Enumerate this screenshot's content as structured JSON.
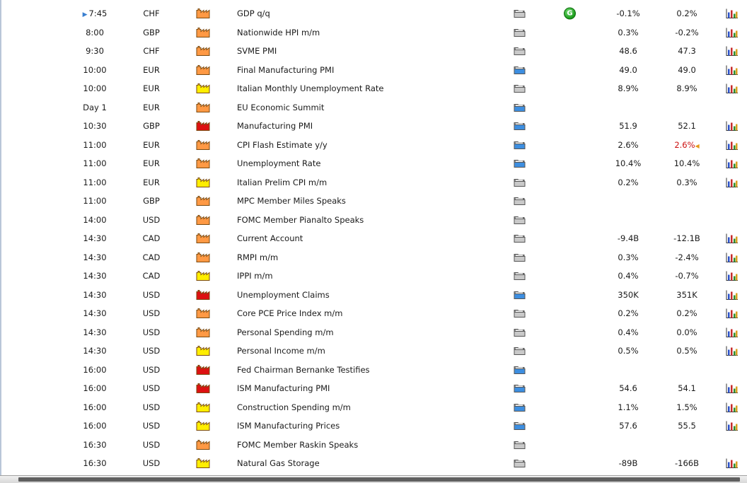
{
  "colors": {
    "high": "#dd1111",
    "medium": "#ff9944",
    "low": "#ffee00"
  },
  "rows": [
    {
      "time": "7:45",
      "currency": "CHF",
      "impact": "medium",
      "event": "GDP q/q",
      "detail": "gray",
      "graph": "G",
      "actual": "-0.1%",
      "forecast": "0.2%",
      "forecast_red": false,
      "chart": true,
      "current": true
    },
    {
      "time": "8:00",
      "currency": "GBP",
      "impact": "medium",
      "event": "Nationwide HPI m/m",
      "detail": "gray",
      "actual": "0.3%",
      "forecast": "-0.2%",
      "forecast_red": false,
      "chart": true
    },
    {
      "time": "9:30",
      "currency": "CHF",
      "impact": "medium",
      "event": "SVME PMI",
      "detail": "gray",
      "actual": "48.6",
      "forecast": "47.3",
      "forecast_red": false,
      "chart": true
    },
    {
      "time": "10:00",
      "currency": "EUR",
      "impact": "medium",
      "event": "Final Manufacturing PMI",
      "detail": "blue",
      "actual": "49.0",
      "forecast": "49.0",
      "forecast_red": false,
      "chart": true
    },
    {
      "time": "10:00",
      "currency": "EUR",
      "impact": "low",
      "event": "Italian Monthly Unemployment Rate",
      "detail": "gray",
      "actual": "8.9%",
      "forecast": "8.9%",
      "forecast_red": false,
      "chart": true
    },
    {
      "time": "Day 1",
      "currency": "EUR",
      "impact": "medium",
      "event": "EU Economic Summit",
      "detail": "blue",
      "actual": "",
      "forecast": "",
      "forecast_red": false,
      "chart": false
    },
    {
      "time": "10:30",
      "currency": "GBP",
      "impact": "high",
      "event": "Manufacturing PMI",
      "detail": "blue",
      "actual": "51.9",
      "forecast": "52.1",
      "forecast_red": false,
      "chart": true
    },
    {
      "time": "11:00",
      "currency": "EUR",
      "impact": "medium",
      "event": "CPI Flash Estimate y/y",
      "detail": "blue",
      "actual": "2.6%",
      "forecast": "2.6%",
      "forecast_red": true,
      "chart": true
    },
    {
      "time": "11:00",
      "currency": "EUR",
      "impact": "medium",
      "event": "Unemployment Rate",
      "detail": "blue",
      "actual": "10.4%",
      "forecast": "10.4%",
      "forecast_red": false,
      "chart": true
    },
    {
      "time": "11:00",
      "currency": "EUR",
      "impact": "low",
      "event": "Italian Prelim CPI m/m",
      "detail": "gray",
      "actual": "0.2%",
      "forecast": "0.3%",
      "forecast_red": false,
      "chart": true
    },
    {
      "time": "11:00",
      "currency": "GBP",
      "impact": "medium",
      "event": "MPC Member Miles Speaks",
      "detail": "gray",
      "actual": "",
      "forecast": "",
      "forecast_red": false,
      "chart": false
    },
    {
      "time": "14:00",
      "currency": "USD",
      "impact": "medium",
      "event": "FOMC Member Pianalto Speaks",
      "detail": "gray",
      "actual": "",
      "forecast": "",
      "forecast_red": false,
      "chart": false
    },
    {
      "time": "14:30",
      "currency": "CAD",
      "impact": "medium",
      "event": "Current Account",
      "detail": "gray",
      "actual": "-9.4B",
      "forecast": "-12.1B",
      "forecast_red": false,
      "chart": true
    },
    {
      "time": "14:30",
      "currency": "CAD",
      "impact": "medium",
      "event": "RMPI m/m",
      "detail": "gray",
      "actual": "0.3%",
      "forecast": "-2.4%",
      "forecast_red": false,
      "chart": true
    },
    {
      "time": "14:30",
      "currency": "CAD",
      "impact": "low",
      "event": "IPPI m/m",
      "detail": "gray",
      "actual": "0.4%",
      "forecast": "-0.7%",
      "forecast_red": false,
      "chart": true
    },
    {
      "time": "14:30",
      "currency": "USD",
      "impact": "high",
      "event": "Unemployment Claims",
      "detail": "blue",
      "actual": "350K",
      "forecast": "351K",
      "forecast_red": false,
      "chart": true
    },
    {
      "time": "14:30",
      "currency": "USD",
      "impact": "medium",
      "event": "Core PCE Price Index m/m",
      "detail": "gray",
      "actual": "0.2%",
      "forecast": "0.2%",
      "forecast_red": false,
      "chart": true
    },
    {
      "time": "14:30",
      "currency": "USD",
      "impact": "medium",
      "event": "Personal Spending m/m",
      "detail": "gray",
      "actual": "0.4%",
      "forecast": "0.0%",
      "forecast_red": false,
      "chart": true
    },
    {
      "time": "14:30",
      "currency": "USD",
      "impact": "low",
      "event": "Personal Income m/m",
      "detail": "gray",
      "actual": "0.5%",
      "forecast": "0.5%",
      "forecast_red": false,
      "chart": true
    },
    {
      "time": "16:00",
      "currency": "USD",
      "impact": "high",
      "event": "Fed Chairman Bernanke Testifies",
      "detail": "blue",
      "actual": "",
      "forecast": "",
      "forecast_red": false,
      "chart": false
    },
    {
      "time": "16:00",
      "currency": "USD",
      "impact": "high",
      "event": "ISM Manufacturing PMI",
      "detail": "blue",
      "actual": "54.6",
      "forecast": "54.1",
      "forecast_red": false,
      "chart": true
    },
    {
      "time": "16:00",
      "currency": "USD",
      "impact": "low",
      "event": "Construction Spending m/m",
      "detail": "blue",
      "actual": "1.1%",
      "forecast": "1.5%",
      "forecast_red": false,
      "chart": true
    },
    {
      "time": "16:00",
      "currency": "USD",
      "impact": "low",
      "event": "ISM Manufacturing Prices",
      "detail": "blue",
      "actual": "57.6",
      "forecast": "55.5",
      "forecast_red": false,
      "chart": true
    },
    {
      "time": "16:30",
      "currency": "USD",
      "impact": "medium",
      "event": "FOMC Member Raskin Speaks",
      "detail": "gray",
      "actual": "",
      "forecast": "",
      "forecast_red": false,
      "chart": false
    },
    {
      "time": "16:30",
      "currency": "USD",
      "impact": "low",
      "event": "Natural Gas Storage",
      "detail": "gray",
      "actual": "-89B",
      "forecast": "-166B",
      "forecast_red": false,
      "chart": true
    }
  ]
}
